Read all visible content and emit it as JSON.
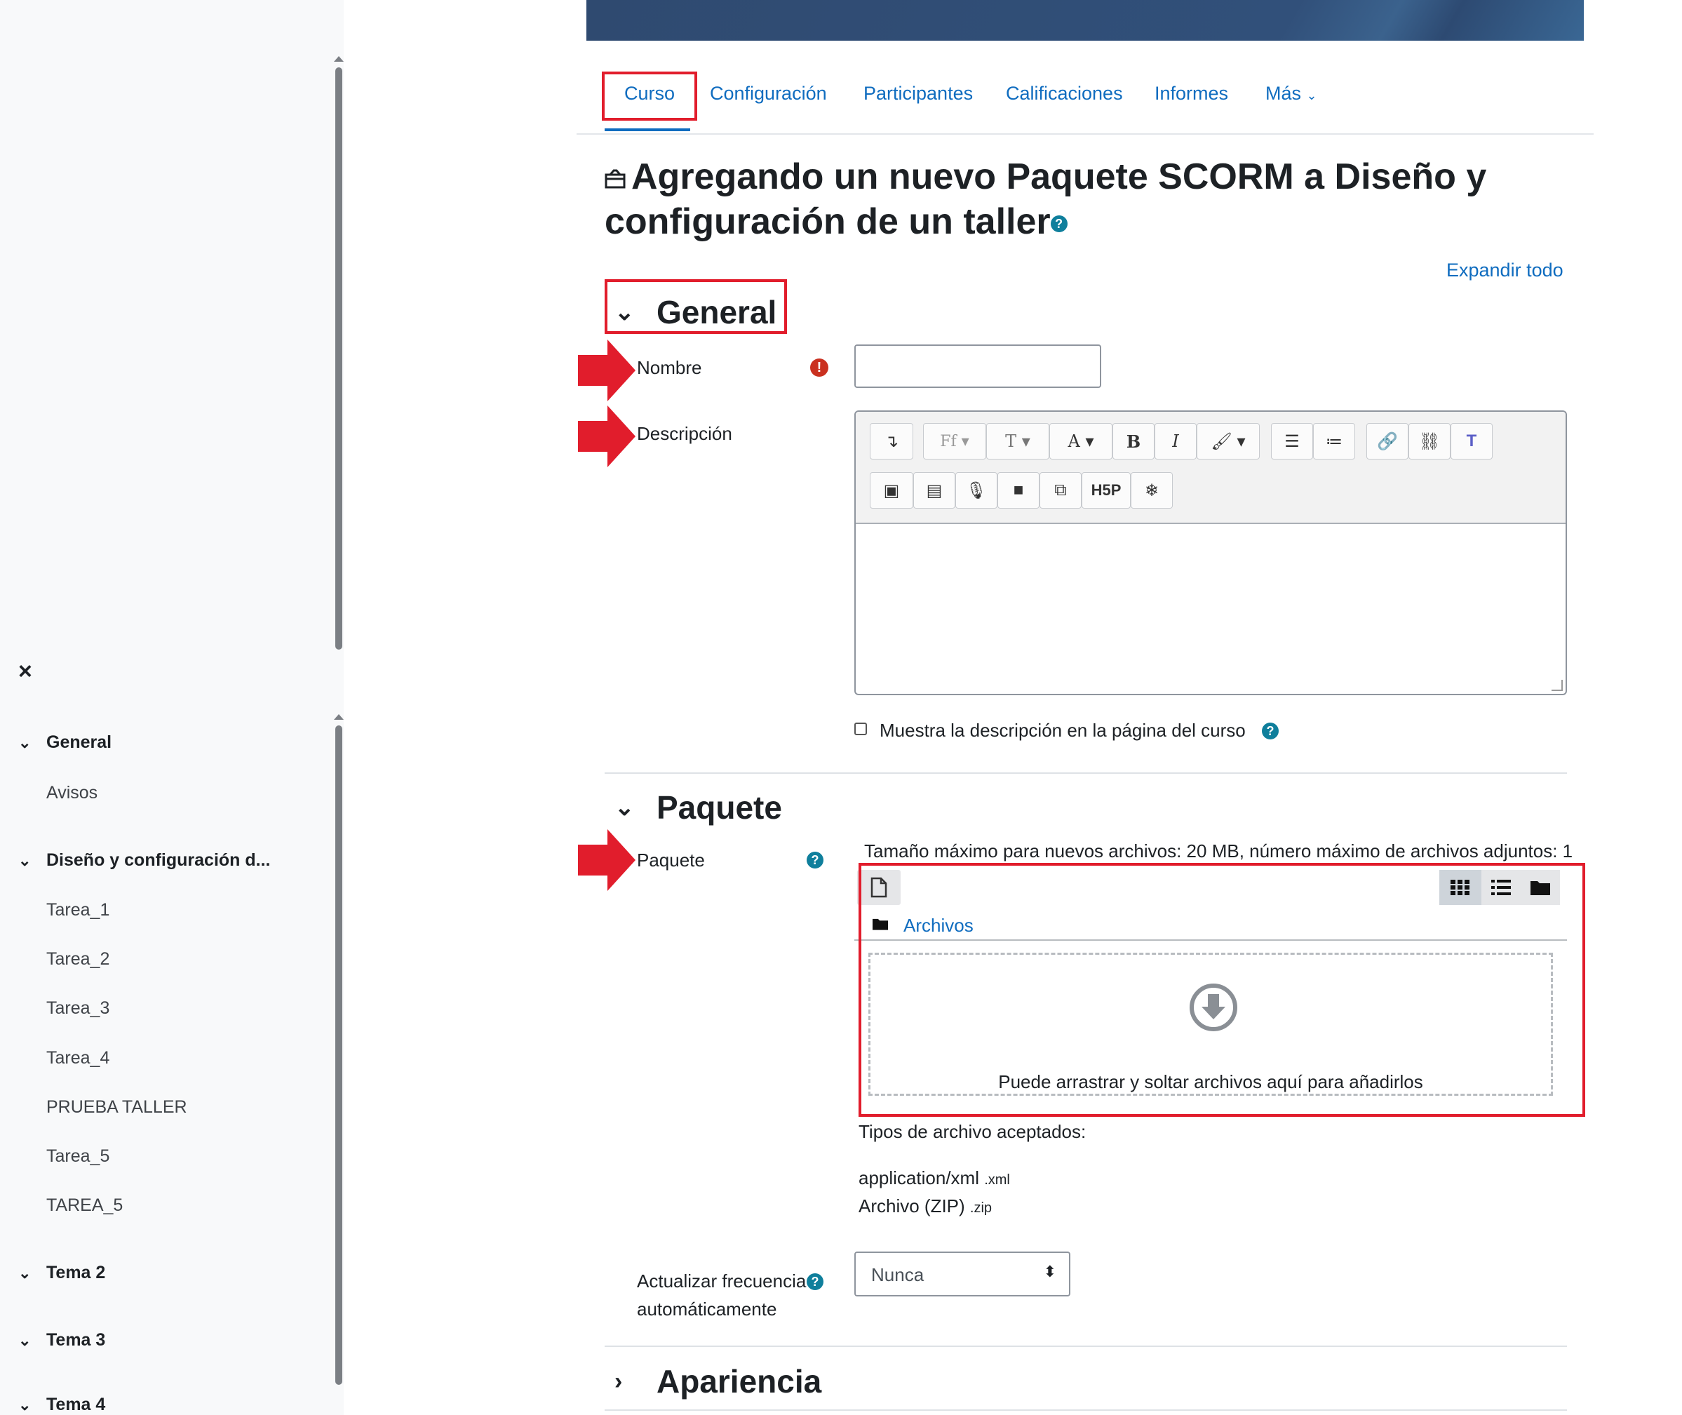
{
  "drawer": {
    "close_label": "×",
    "sections": [
      {
        "title": "General",
        "items": [
          "Avisos"
        ]
      },
      {
        "title": "Diseño y configuración d...",
        "items": [
          "Tarea_1",
          "Tarea_2",
          "Tarea_3",
          "Tarea_4",
          "PRUEBA TALLER",
          "Tarea_5",
          "TAREA_5"
        ]
      },
      {
        "title": "Tema 2",
        "items": []
      },
      {
        "title": "Tema 3",
        "items": []
      },
      {
        "title": "Tema 4",
        "items": []
      }
    ]
  },
  "tabs": [
    "Curso",
    "Configuración",
    "Participantes",
    "Calificaciones",
    "Informes",
    "Más"
  ],
  "page": {
    "title_line1": "Agregando un nuevo Paquete SCORM a Diseño y",
    "title_line2": "configuración de un taller",
    "help_glyph": "?",
    "expand_all": "Expandir todo"
  },
  "general": {
    "heading": "General",
    "name_label": "Nombre",
    "required_glyph": "!",
    "description_label": "Descripción",
    "show_description_label": "Muestra la descripción en la página del curso"
  },
  "package": {
    "heading": "Paquete",
    "label": "Paquete",
    "max_size_text": "Tamaño máximo para nuevos archivos: 20 MB, número máximo de archivos adjuntos: 1",
    "files_folder": "Archivos",
    "drop_text": "Puede arrastrar y soltar archivos aquí para añadirlos",
    "accepted_types_label": "Tipos de archivo aceptados:",
    "accepted_types": [
      {
        "name": "application/xml",
        "ext": ".xml"
      },
      {
        "name": "Archivo (ZIP)",
        "ext": ".zip"
      }
    ],
    "update_frequency_label_1": "Actualizar frecuencia",
    "update_frequency_label_2": "automáticamente",
    "update_frequency_value": "Nunca"
  },
  "appearance": {
    "heading": "Apariencia"
  },
  "editor_toolbar": {
    "row1": [
      "↴",
      "Ff",
      "T",
      "A",
      "B",
      "I",
      "brush",
      "ul",
      "ol",
      "link",
      "unlink",
      "teams"
    ],
    "row2": [
      "image",
      "media",
      "mic",
      "video",
      "copy",
      "H5P",
      "snow"
    ]
  },
  "colors": {
    "link": "#0f6cbf",
    "highlight_red": "#e11d2c",
    "help_teal": "#0f7f9c",
    "required_red": "#ca3120"
  }
}
